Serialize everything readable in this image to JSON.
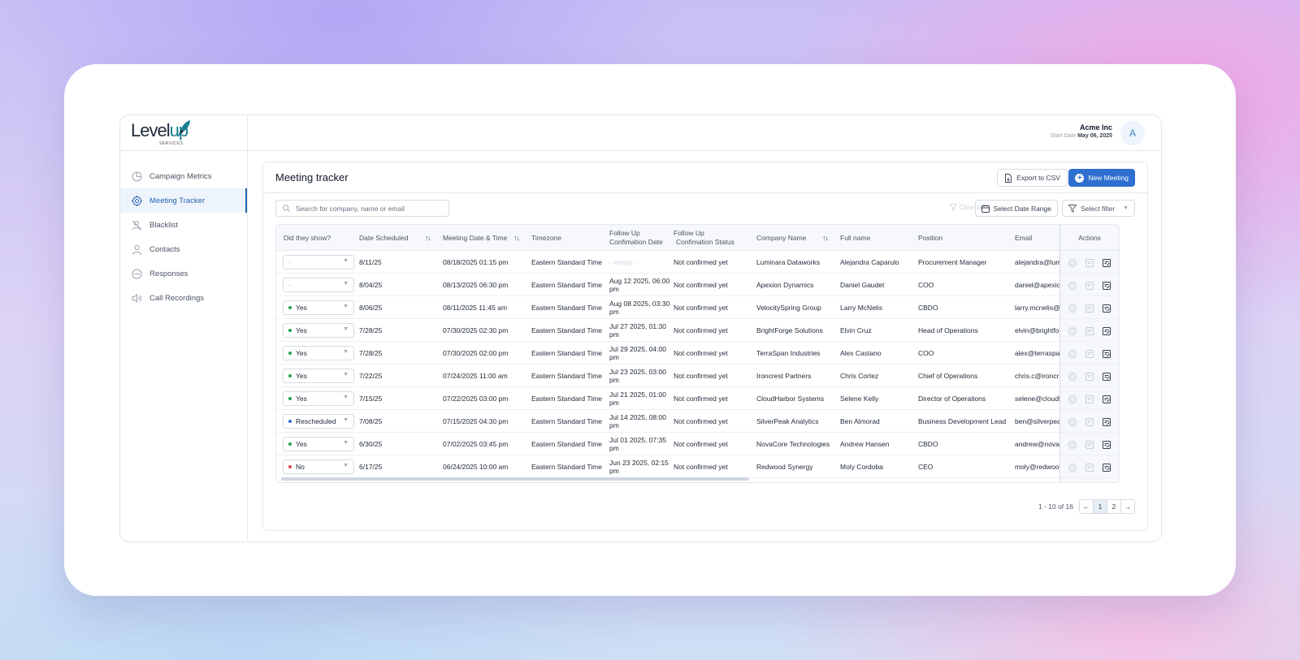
{
  "brand": {
    "logo_main": "Level",
    "logo_accent": "up",
    "logo_sub": "SERVICES"
  },
  "sidebar": {
    "items": [
      {
        "label": "Campaign Metrics",
        "icon": "chart-circle-icon"
      },
      {
        "label": "Meeting Tracker",
        "icon": "target-icon",
        "active": true
      },
      {
        "label": "Blacklist",
        "icon": "user-block-icon"
      },
      {
        "label": "Contacts",
        "icon": "user-icon"
      },
      {
        "label": "Responses",
        "icon": "circle-minus-icon"
      },
      {
        "label": "Call Recordings",
        "icon": "speaker-icon"
      }
    ]
  },
  "header": {
    "company": "Acme Inc",
    "start_label": "Start Date",
    "start_date": "May 06, 2025",
    "avatar_letter": "A"
  },
  "page": {
    "title": "Meeting tracker",
    "export_label": "Export to CSV",
    "new_meeting_label": "New Meeting",
    "search_placeholder": "Search for company, name or email",
    "clear_all_label": "Clear all",
    "date_range_label": "Select Date Range",
    "filter_label": "Select filter"
  },
  "table": {
    "columns": {
      "did_show": "Did they show?",
      "date_scheduled": "Date Scheduled",
      "meeting_dt": "Meeting Date & Time",
      "timezone": "Timezone",
      "fu_date_1": "Follow Up",
      "fu_date_2": "Confimation Date",
      "fu_status_1": "Follow Up",
      "fu_status_2": "Confimation Status",
      "company": "Company Name",
      "full_name": "Full name",
      "position": "Position",
      "email": "Email",
      "actions": "Actions"
    },
    "sort_icon": "↑↓",
    "rows": [
      {
        "show": "",
        "show_color": "",
        "scheduled": "8/11/25",
        "meeting": "08/18/2025 01:15 pm",
        "tz": "Eastern Standard Time",
        "fu_date": "- empty -",
        "fu_status": "Not confirmed yet",
        "company": "Luminara Dataworks",
        "name": "Alejandra Caparulo",
        "position": "Procurement Manager",
        "email": "alejandra@luminaradataworks.com"
      },
      {
        "show": "",
        "show_color": "",
        "scheduled": "8/04/25",
        "meeting": "08/13/2025 06:30 pm",
        "tz": "Eastern Standard Time",
        "fu_date": "Aug 12 2025, 06:00 pm",
        "fu_status": "Not confirmed yet",
        "company": "Apexion Dynamics",
        "name": "Daniel Gaudet",
        "position": "COO",
        "email": "daniel@apexiondynamics.com"
      },
      {
        "show": "Yes",
        "show_color": "#22a34a",
        "scheduled": "8/06/25",
        "meeting": "08/11/2025 11:45 am",
        "tz": "Eastern Standard Time",
        "fu_date": "Aug 08 2025, 03:30 pm",
        "fu_status": "Not confirmed yet",
        "company": "VelocitySpring Group",
        "name": "Larry McNelis",
        "position": "CBDO",
        "email": "larry.mcnelis@velocityspring.com"
      },
      {
        "show": "Yes",
        "show_color": "#22a34a",
        "scheduled": "7/28/25",
        "meeting": "07/30/2025 02:30 pm",
        "tz": "Eastern Standard Time",
        "fu_date": "Jul 27 2025, 01:30 pm",
        "fu_status": "Not confirmed yet",
        "company": "BrightForge Solutions",
        "name": "Elvin Cruz",
        "position": "Head of Operations",
        "email": "elvin@brightforge.com"
      },
      {
        "show": "Yes",
        "show_color": "#22a34a",
        "scheduled": "7/28/25",
        "meeting": "07/30/2025 02:00 pm",
        "tz": "Eastern Standard Time",
        "fu_date": "Jul 29 2025, 04:00 pm",
        "fu_status": "Not confirmed yet",
        "company": "TerraSpan Industries",
        "name": "Alex Castano",
        "position": "COO",
        "email": "alex@terraspan.com"
      },
      {
        "show": "Yes",
        "show_color": "#22a34a",
        "scheduled": "7/22/25",
        "meeting": "07/24/2025 11:00 am",
        "tz": "Eastern Standard Time",
        "fu_date": "Jul 23 2025, 03:00 pm",
        "fu_status": "Not confirmed yet",
        "company": "Ironcrest Partners",
        "name": "Chris Cortez",
        "position": "Chief of Operations",
        "email": "chris.c@ironcrest.com"
      },
      {
        "show": "Yes",
        "show_color": "#22a34a",
        "scheduled": "7/15/25",
        "meeting": "07/22/2025 03:00 pm",
        "tz": "Eastern Standard Time",
        "fu_date": "Jul 21 2025, 01:00 pm",
        "fu_status": "Not confirmed yet",
        "company": "CloudHarbor Systems",
        "name": "Selene Kelly",
        "position": "Director of Operations",
        "email": "selene@cloudharbor.com"
      },
      {
        "show": "Rescheduled",
        "show_color": "#2f6fd0",
        "scheduled": "7/08/25",
        "meeting": "07/15/2025 04:30 pm",
        "tz": "Eastern Standard Time",
        "fu_date": "Jul 14 2025, 08:00 pm",
        "fu_status": "Not confirmed yet",
        "company": "SilverPeak Analytics",
        "name": "Ben Almorad",
        "position": "Business Development Lead",
        "email": "ben@silverpeak.com"
      },
      {
        "show": "Yes",
        "show_color": "#22a34a",
        "scheduled": "6/30/25",
        "meeting": "07/02/2025 03:45 pm",
        "tz": "Eastern Standard Time",
        "fu_date": "Jul 01 2025, 07:35 pm",
        "fu_status": "Not confirmed yet",
        "company": "NovaCore Technologies",
        "name": "Andrew Hansen",
        "position": "CBDO",
        "email": "andrew@novacore.com"
      },
      {
        "show": "No",
        "show_color": "#e0474c",
        "scheduled": "6/17/25",
        "meeting": "06/24/2025 10:00 am",
        "tz": "Eastern Standard Time",
        "fu_date": "Jun 23 2025, 02:15 pm",
        "fu_status": "Not confirmed yet",
        "company": "Redwood Synergy",
        "name": "Moly Cordoba",
        "position": "CEO",
        "email": "moly@redwoodsynergy.com"
      }
    ]
  },
  "pagination": {
    "info": "1 - 10 of 16",
    "prev": "←",
    "pages": [
      "1",
      "2"
    ],
    "next": "→",
    "current": "1"
  },
  "colors": {
    "accent": "#2f6fd0",
    "active_nav_bg": "#eef4fb",
    "yes": "#22a34a",
    "no": "#e0474c",
    "rescheduled": "#2f6fd0"
  }
}
